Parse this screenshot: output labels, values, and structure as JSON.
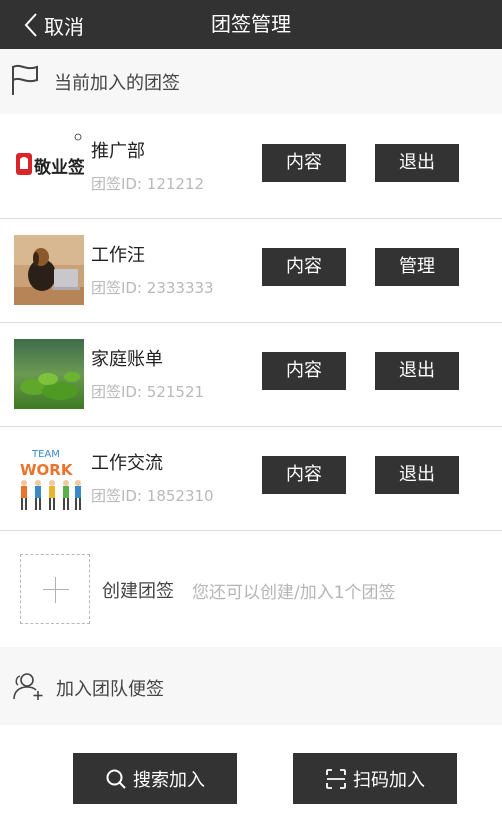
{
  "header": {
    "back_label": "取消",
    "title": "团签管理"
  },
  "current_section": {
    "label": "当前加入的团签"
  },
  "teams": [
    {
      "name": "推广部",
      "id_text": "团签ID: 121212",
      "btn_content": "内容",
      "btn_action": "退出",
      "thumb_text": "敬业签"
    },
    {
      "name": "工作汪",
      "id_text": "团签ID: 2333333",
      "btn_content": "内容",
      "btn_action": "管理"
    },
    {
      "name": "家庭账单",
      "id_text": "团签ID: 521521",
      "btn_content": "内容",
      "btn_action": "退出"
    },
    {
      "name": "工作交流",
      "id_text": "团签ID: 1852310",
      "btn_content": "内容",
      "btn_action": "退出",
      "thumb_text_1": "TEAM",
      "thumb_text_2": "WORK"
    }
  ],
  "create": {
    "label": "创建团签",
    "hint": "您还可以创建/加入1个团签"
  },
  "join_section": {
    "label": "加入团队便签"
  },
  "actions": {
    "search_join": "搜索加入",
    "scan_join": "扫码加入"
  },
  "colors": {
    "header_bg": "#323232",
    "button_bg": "#333333",
    "section_bg": "#f7f7f7",
    "logo_red": "#d9252a"
  }
}
